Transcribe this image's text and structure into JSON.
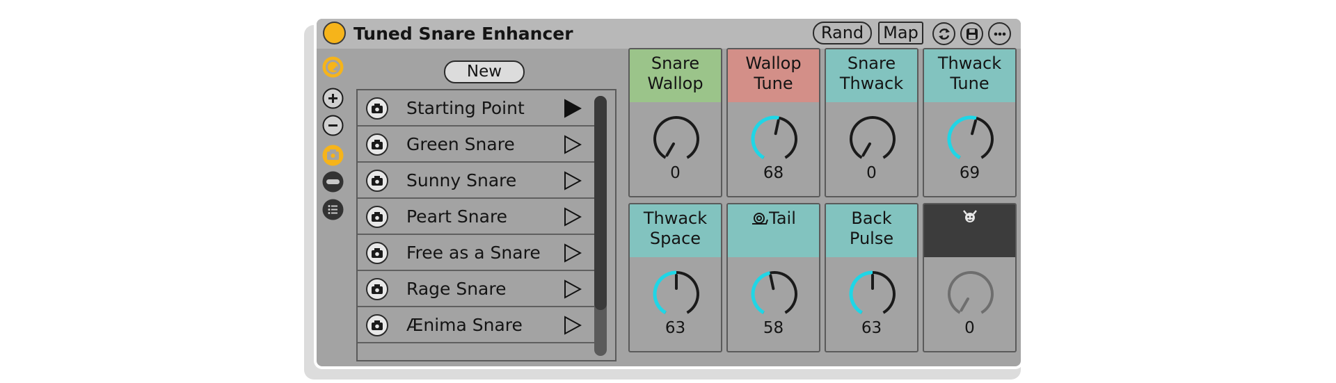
{
  "device": {
    "title": "Tuned Snare Enhancer",
    "rand_label": "Rand",
    "map_label": "Map"
  },
  "browser": {
    "new_label": "New",
    "presets": [
      {
        "label": "Starting Point",
        "active": true
      },
      {
        "label": "Green Snare",
        "active": false
      },
      {
        "label": "Sunny Snare",
        "active": false
      },
      {
        "label": "Peart Snare",
        "active": false
      },
      {
        "label": "Free as a Snare",
        "active": false
      },
      {
        "label": "Rage Snare",
        "active": false
      },
      {
        "label": "Ænima Snare",
        "active": false
      }
    ]
  },
  "knobs": [
    {
      "label": "Snare Wallop",
      "value": "0",
      "level": 0,
      "header_color": "#9bc48a"
    },
    {
      "label": "Wallop Tune",
      "value": "68",
      "level": 0.54,
      "header_color": "#d38f88"
    },
    {
      "label": "Snare Thwack",
      "value": "0",
      "level": 0,
      "header_color": "#82c3bf"
    },
    {
      "label": "Thwack Tune",
      "value": "69",
      "level": 0.55,
      "header_color": "#82c3bf"
    },
    {
      "label": "Thwack Space",
      "value": "63",
      "level": 0.5,
      "header_color": "#82c3bf"
    },
    {
      "label": "Tail",
      "value": "58",
      "level": 0.46,
      "header_color": "#82c3bf",
      "icon": "snail-icon"
    },
    {
      "label": "Back Pulse",
      "value": "63",
      "level": 0.5,
      "header_color": "#82c3bf"
    },
    {
      "label": "",
      "value": "0",
      "level": 0,
      "header_color": "#3c3c3c",
      "icon": "devil-icon",
      "disabled": true
    }
  ],
  "colors": {
    "accent": "#f6b41a",
    "knob_arc": "#1fd6e6"
  },
  "icons": [
    "refresh-icon",
    "save-icon",
    "more-icon",
    "undo-icon",
    "plus-icon",
    "minus-icon",
    "camera-icon",
    "random-icon",
    "list-icon",
    "play-icon"
  ]
}
